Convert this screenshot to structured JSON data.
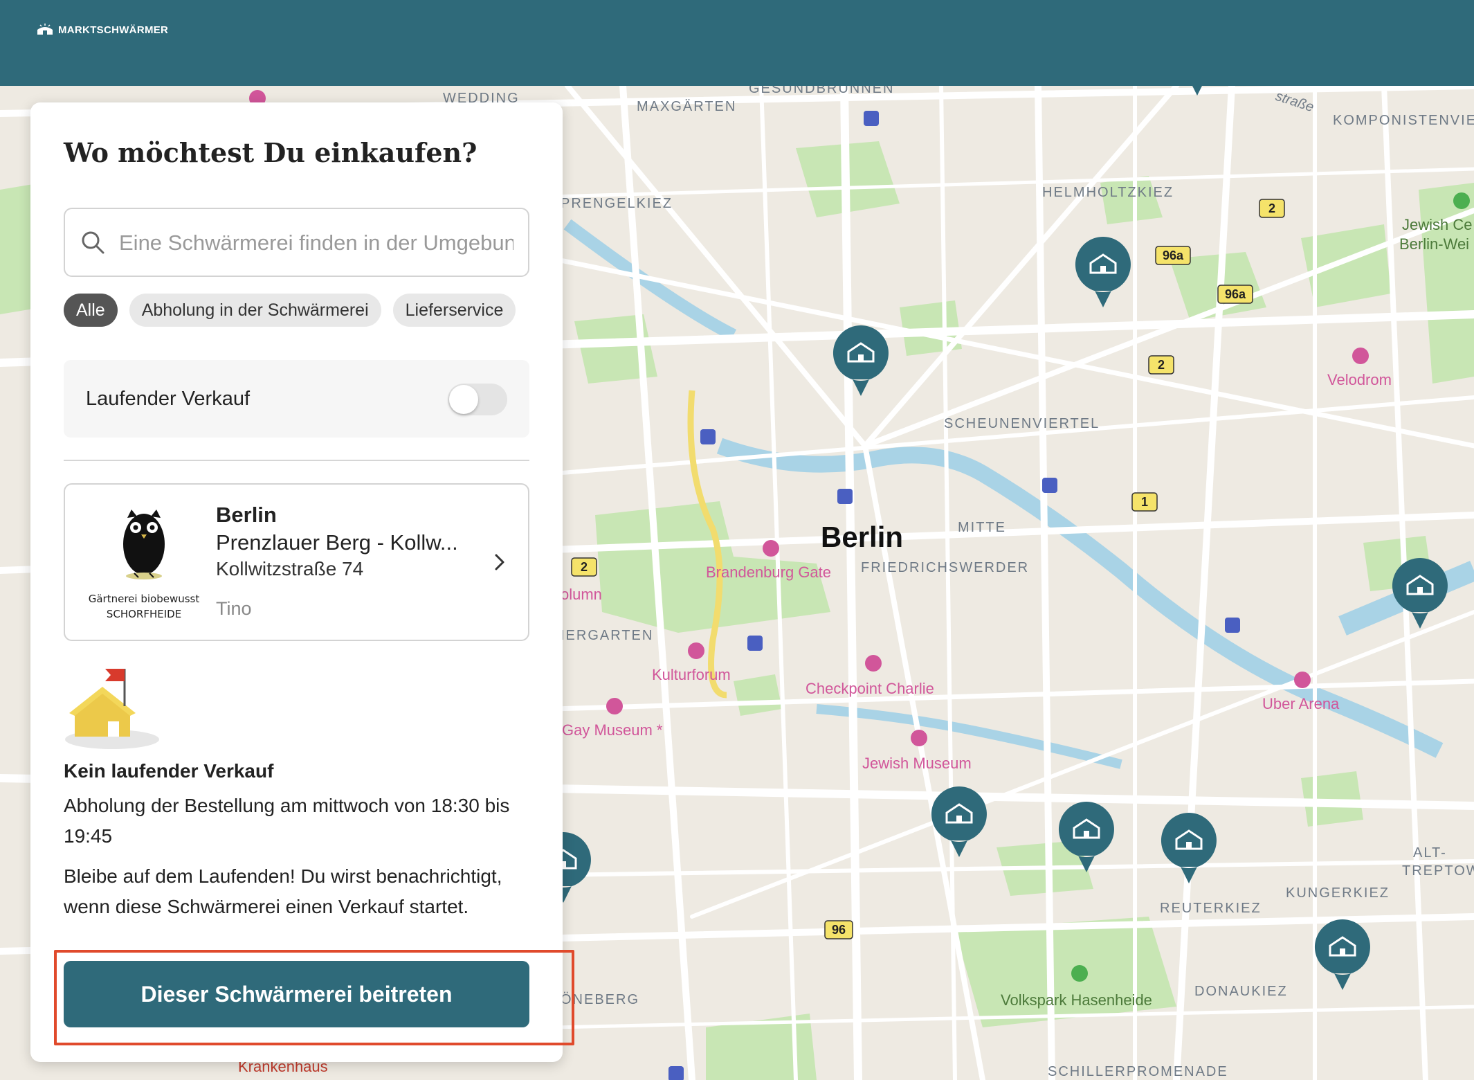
{
  "header": {
    "logo_text": "MARKTSCHWÄRMER"
  },
  "panel": {
    "title": "Wo möchtest Du einkaufen?",
    "search": {
      "placeholder": "Eine Schwärmerei finden in der Umgebung",
      "value": ""
    },
    "filters": [
      {
        "label": "Alle",
        "active": true
      },
      {
        "label": "Abholung in der Schwärmerei",
        "active": false
      },
      {
        "label": "Lieferservice",
        "active": false
      }
    ],
    "toggle": {
      "label": "Laufender Verkauf",
      "on": false
    },
    "market": {
      "city": "Berlin",
      "name": "Prenzlauer Berg - Kollw...",
      "address": "Kollwitzstraße 74",
      "host": "Tino",
      "logo_text_line1": "Gärtnerei biobewusst",
      "logo_text_line2": "SCHORFHEIDE"
    },
    "status_title": "Kein laufender Verkauf",
    "pickup_text": "Abholung der Bestellung am mittwoch von 18:30 bis 19:45",
    "notify_text": "Bleibe auf dem Laufenden! Du wirst benachrichtigt, wenn diese Schwärmerei einen Verkauf startet.",
    "join_button": "Dieser Schwärmerei beitreten"
  },
  "map": {
    "city_label": "Berlin",
    "districts": [
      "WEDDING",
      "GESUNDBRUNNEN",
      "MAXGÄRTEN",
      "KOMPONISTENVIERTEL",
      "PRENGELKIEZ",
      "HELMHOLTZKIEZ",
      "SCHEUNENVIERTEL",
      "MITTE",
      "FRIEDRICHSWERDER",
      "IERGARTEN",
      "REUTERKIEZ",
      "KUNGERKIEZ",
      "DONAUKIEZ",
      "ALT-",
      "TREPTOW",
      "ÖNEBERG",
      "SCHILLERPROMENADE"
    ],
    "pois": [
      "Brandenburg Gate",
      "Checkpoint Charlie",
      "Kulturforum",
      "Gay Museum *",
      "Jewish Museum",
      "Velodrom",
      "Uber Arena",
      "Volkspark Hasenheide",
      "Krankenhaus",
      "Jewish Ce",
      "Berlin-Wei",
      "olumn"
    ],
    "street_label": "straße",
    "road_badges": [
      "2",
      "96a",
      "96a",
      "2",
      "1",
      "2",
      "96"
    ],
    "colors": {
      "park": "#c8e6b4",
      "water": "#a9d3e6",
      "road": "#ffffff",
      "background": "#eeeae2",
      "marker": "#2f6a7a",
      "poi": "#d1569a"
    }
  }
}
